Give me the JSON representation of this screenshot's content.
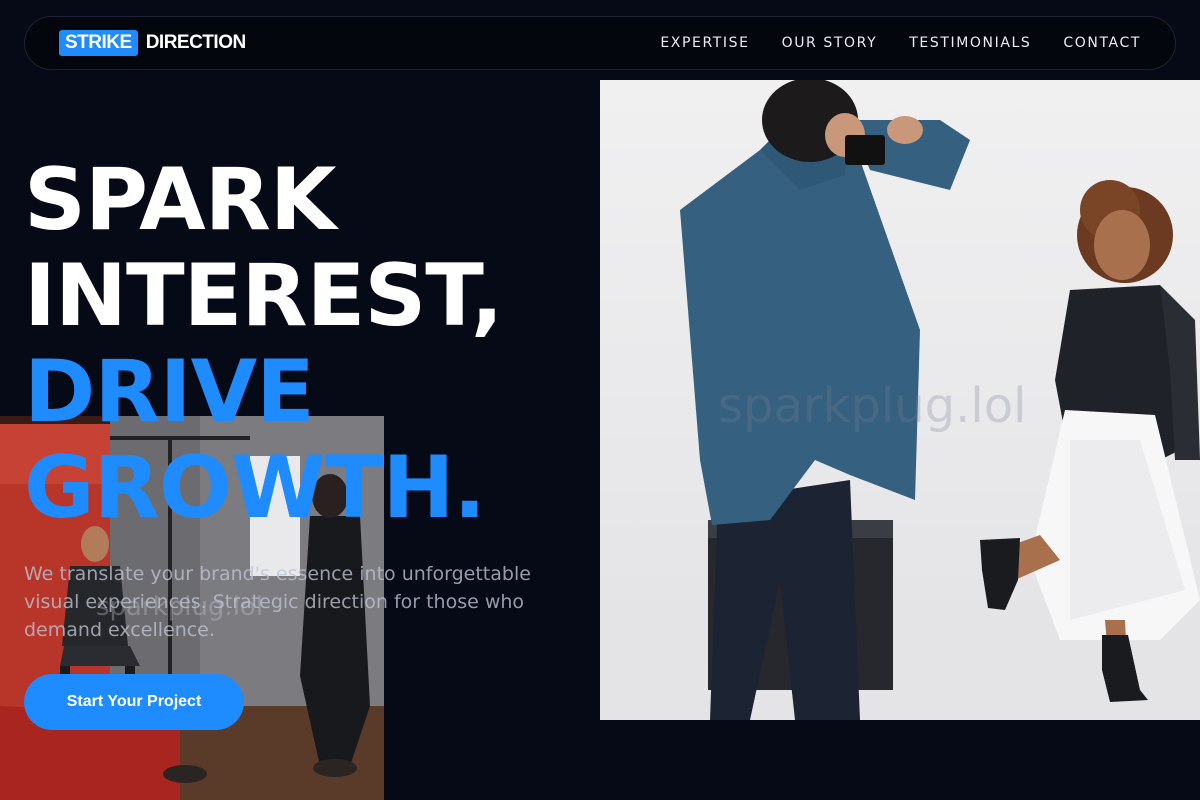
{
  "brand": {
    "box_text": "STRIKE",
    "text": "DIRECTION",
    "accent": "#1e8bff"
  },
  "nav": {
    "items": [
      {
        "label": "EXPERTISE"
      },
      {
        "label": "OUR STORY"
      },
      {
        "label": "TESTIMONIALS"
      },
      {
        "label": "CONTACT"
      }
    ]
  },
  "hero": {
    "title_lines": [
      {
        "text": "SPARK",
        "color": "white"
      },
      {
        "text": "INTEREST,",
        "color": "white"
      },
      {
        "text": "DRIVE",
        "color": "blue"
      },
      {
        "text": "GROWTH.",
        "color": "blue"
      }
    ],
    "subtitle_lines": [
      "We translate your brand's essence into unforgettable",
      "visual experiences. Strategic direction for those who",
      "demand excellence."
    ],
    "cta_label": "Start Your Project"
  },
  "watermarks": {
    "right": "sparkplug.lol",
    "left": "sparkplug.lol"
  },
  "colors": {
    "background": "#060a17",
    "accent": "#1e8bff",
    "text": "#ffffff"
  }
}
